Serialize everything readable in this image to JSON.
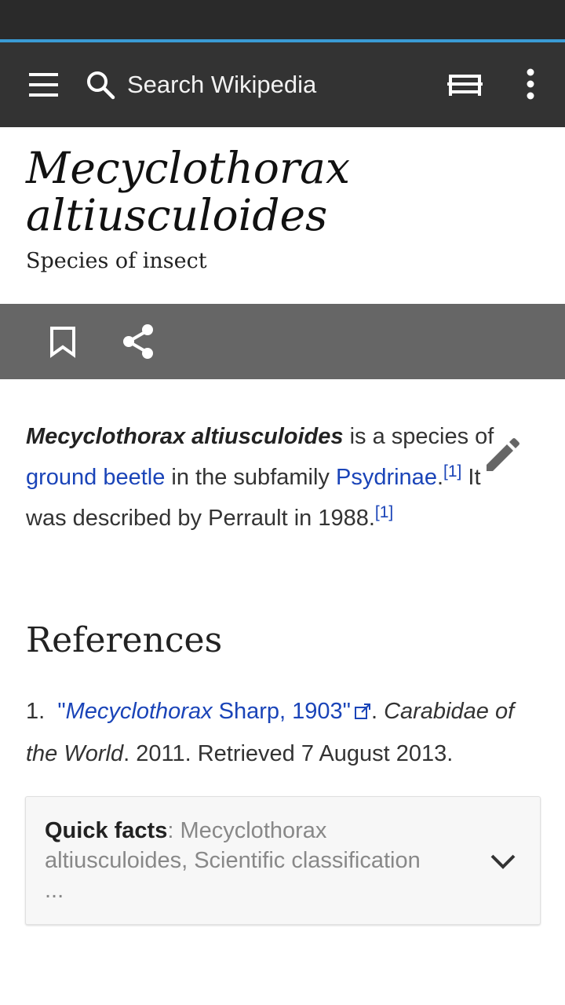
{
  "toolbar": {
    "search_placeholder": "Search Wikipedia"
  },
  "article": {
    "title": "Mecyclothorax altiusculoides",
    "description": "Species of insect",
    "lead": {
      "bold_name": "Mecyclothorax altiusculoides",
      "text_1": " is a species of ",
      "link_ground_beetle": "ground beetle",
      "text_2": " in the subfamily ",
      "link_psydrinae": "Psydrinae",
      "text_3": ".",
      "cite_1": "[1]",
      "text_4": " It was described by Perrault in 1988.",
      "cite_2": "[1]"
    }
  },
  "references": {
    "heading": "References",
    "items": [
      {
        "number": "1.",
        "link_open_quote": "\"",
        "link_italic": "Mecyclothorax",
        "link_rest": " Sharp, 1903\"",
        "work_sep": ". ",
        "work": "Carabidae of the World",
        "rest": ". 2011. Retrieved 7 August 2013."
      }
    ]
  },
  "quick_facts": {
    "label": "Quick facts",
    "text": ": Mecyclothorax altiusculoides, Scientific classification ..."
  },
  "colors": {
    "toolbar_bg": "#333333",
    "action_bar_bg": "#666666",
    "link": "#1a44b8",
    "progress": "#3a9bd5"
  },
  "icons": [
    "menu-icon",
    "search-icon",
    "reading-list-icon",
    "more-vert-icon",
    "bookmark-icon",
    "share-icon",
    "edit-pencil-icon",
    "external-link-icon",
    "chevron-down-icon"
  ]
}
